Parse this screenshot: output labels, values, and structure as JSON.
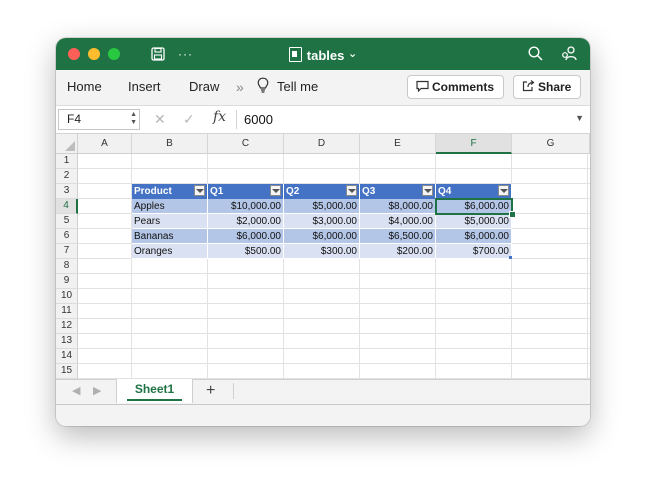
{
  "window": {
    "title": "tables",
    "chevron": "⌄",
    "more_glyph": "···"
  },
  "ribbon": {
    "tabs": [
      "Home",
      "Insert",
      "Draw"
    ],
    "overflow_glyph": "»",
    "tell_me": "Tell me",
    "comments_label": "Comments",
    "share_label": "Share"
  },
  "formula_bar": {
    "name_box": "F4",
    "fx": "fx",
    "value": "6000"
  },
  "columns": [
    "A",
    "B",
    "C",
    "D",
    "E",
    "F",
    "G"
  ],
  "rows": [
    "1",
    "2",
    "3",
    "4",
    "5",
    "6",
    "7",
    "8",
    "9",
    "10",
    "11",
    "12",
    "13",
    "14",
    "15"
  ],
  "selected_cell": {
    "column": "F",
    "row": "4"
  },
  "table": {
    "headers": [
      "Product",
      "Q1",
      "Q2",
      "Q3",
      "Q4"
    ],
    "rows": [
      [
        "Apples",
        "$10,000.00",
        "$5,000.00",
        "$8,000.00",
        "$6,000.00"
      ],
      [
        "Pears",
        "$2,000.00",
        "$3,000.00",
        "$4,000.00",
        "$5,000.00"
      ],
      [
        "Bananas",
        "$6,000.00",
        "$6,000.00",
        "$6,500.00",
        "$6,000.00"
      ],
      [
        "Oranges",
        "$500.00",
        "$300.00",
        "$200.00",
        "$700.00"
      ]
    ],
    "style": {
      "header_bg": "#4472c4",
      "band_dark": "#b4c6e7",
      "band_light": "#d9e1f2"
    }
  },
  "sheet_tabs": {
    "active": "Sheet1",
    "add_glyph": "+"
  },
  "colors": {
    "accent": "#1f7244"
  },
  "icons": [
    "save-icon",
    "more-icon",
    "search-icon",
    "share-people-icon",
    "lightbulb-icon",
    "comment-icon",
    "share-icon",
    "cancel-icon",
    "confirm-icon",
    "prev-sheet-icon",
    "next-sheet-icon"
  ]
}
